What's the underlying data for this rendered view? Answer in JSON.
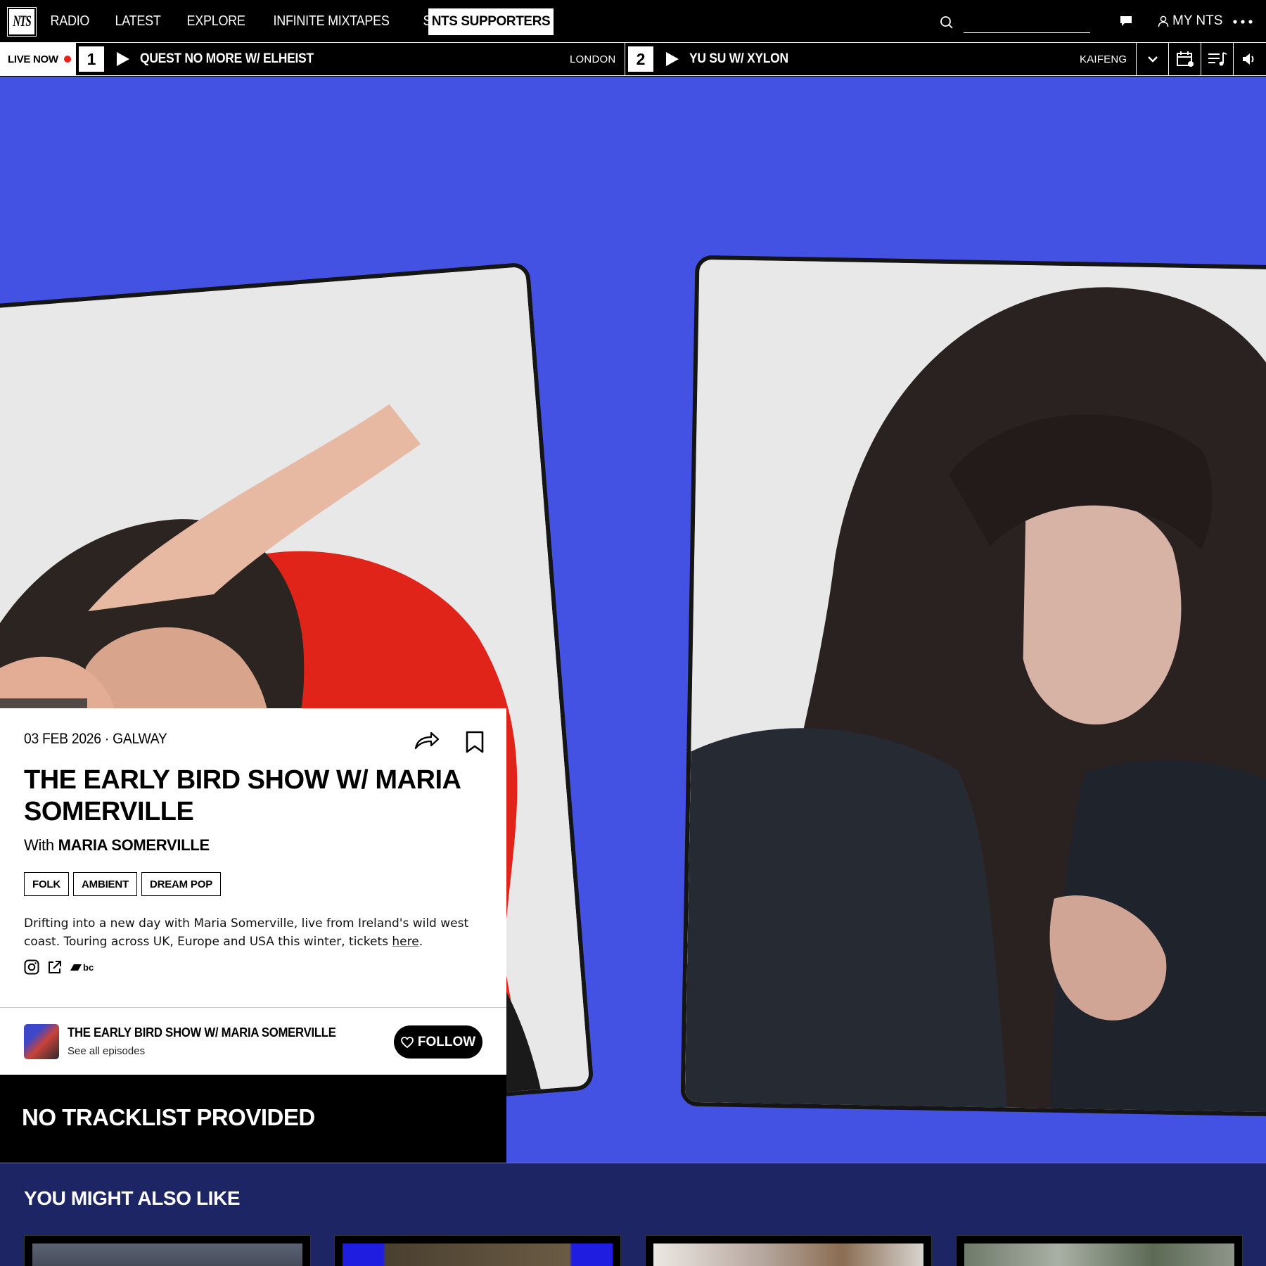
{
  "nav": {
    "logo": "NTS",
    "links": [
      "RADIO",
      "LATEST",
      "EXPLORE",
      "INFINITE MIXTAPES",
      "SHOP"
    ],
    "supporters": "NTS SUPPORTERS",
    "search_placeholder": "",
    "my_nts": "MY NTS"
  },
  "live": {
    "label": "LIVE NOW",
    "channels": [
      {
        "number": "1",
        "title": "QUEST NO MORE W/ ELHEIST",
        "location": "LONDON"
      },
      {
        "number": "2",
        "title": "YU SU W/ XYLON",
        "location": "KAIFENG"
      }
    ]
  },
  "episode": {
    "date": "03 FEB 2026",
    "location": "GALWAY",
    "title": "THE EARLY BIRD SHOW W/ MARIA SOMERVILLE",
    "with_prefix": "With",
    "host": "MARIA SOMERVILLE",
    "tags": [
      "FOLK",
      "AMBIENT",
      "DREAM POP"
    ],
    "description": "Drifting into a new day with Maria Somerville, live from Ireland's wild west coast. Touring across UK, Europe and USA this winter, tickets ",
    "description_link": "here",
    "description_end": ".",
    "bandcamp": "bc"
  },
  "show": {
    "title": "THE EARLY BIRD SHOW W/ MARIA SOMERVILLE",
    "subtitle": "See all episodes",
    "follow": "FOLLOW"
  },
  "tracklist": {
    "heading": "NO TRACKLIST PROVIDED"
  },
  "also": {
    "heading": "YOU MIGHT ALSO LIKE"
  },
  "colors": {
    "hero_bg": "#4452e3",
    "also_bg": "#1e2564",
    "live_dot": "#e8211a"
  }
}
